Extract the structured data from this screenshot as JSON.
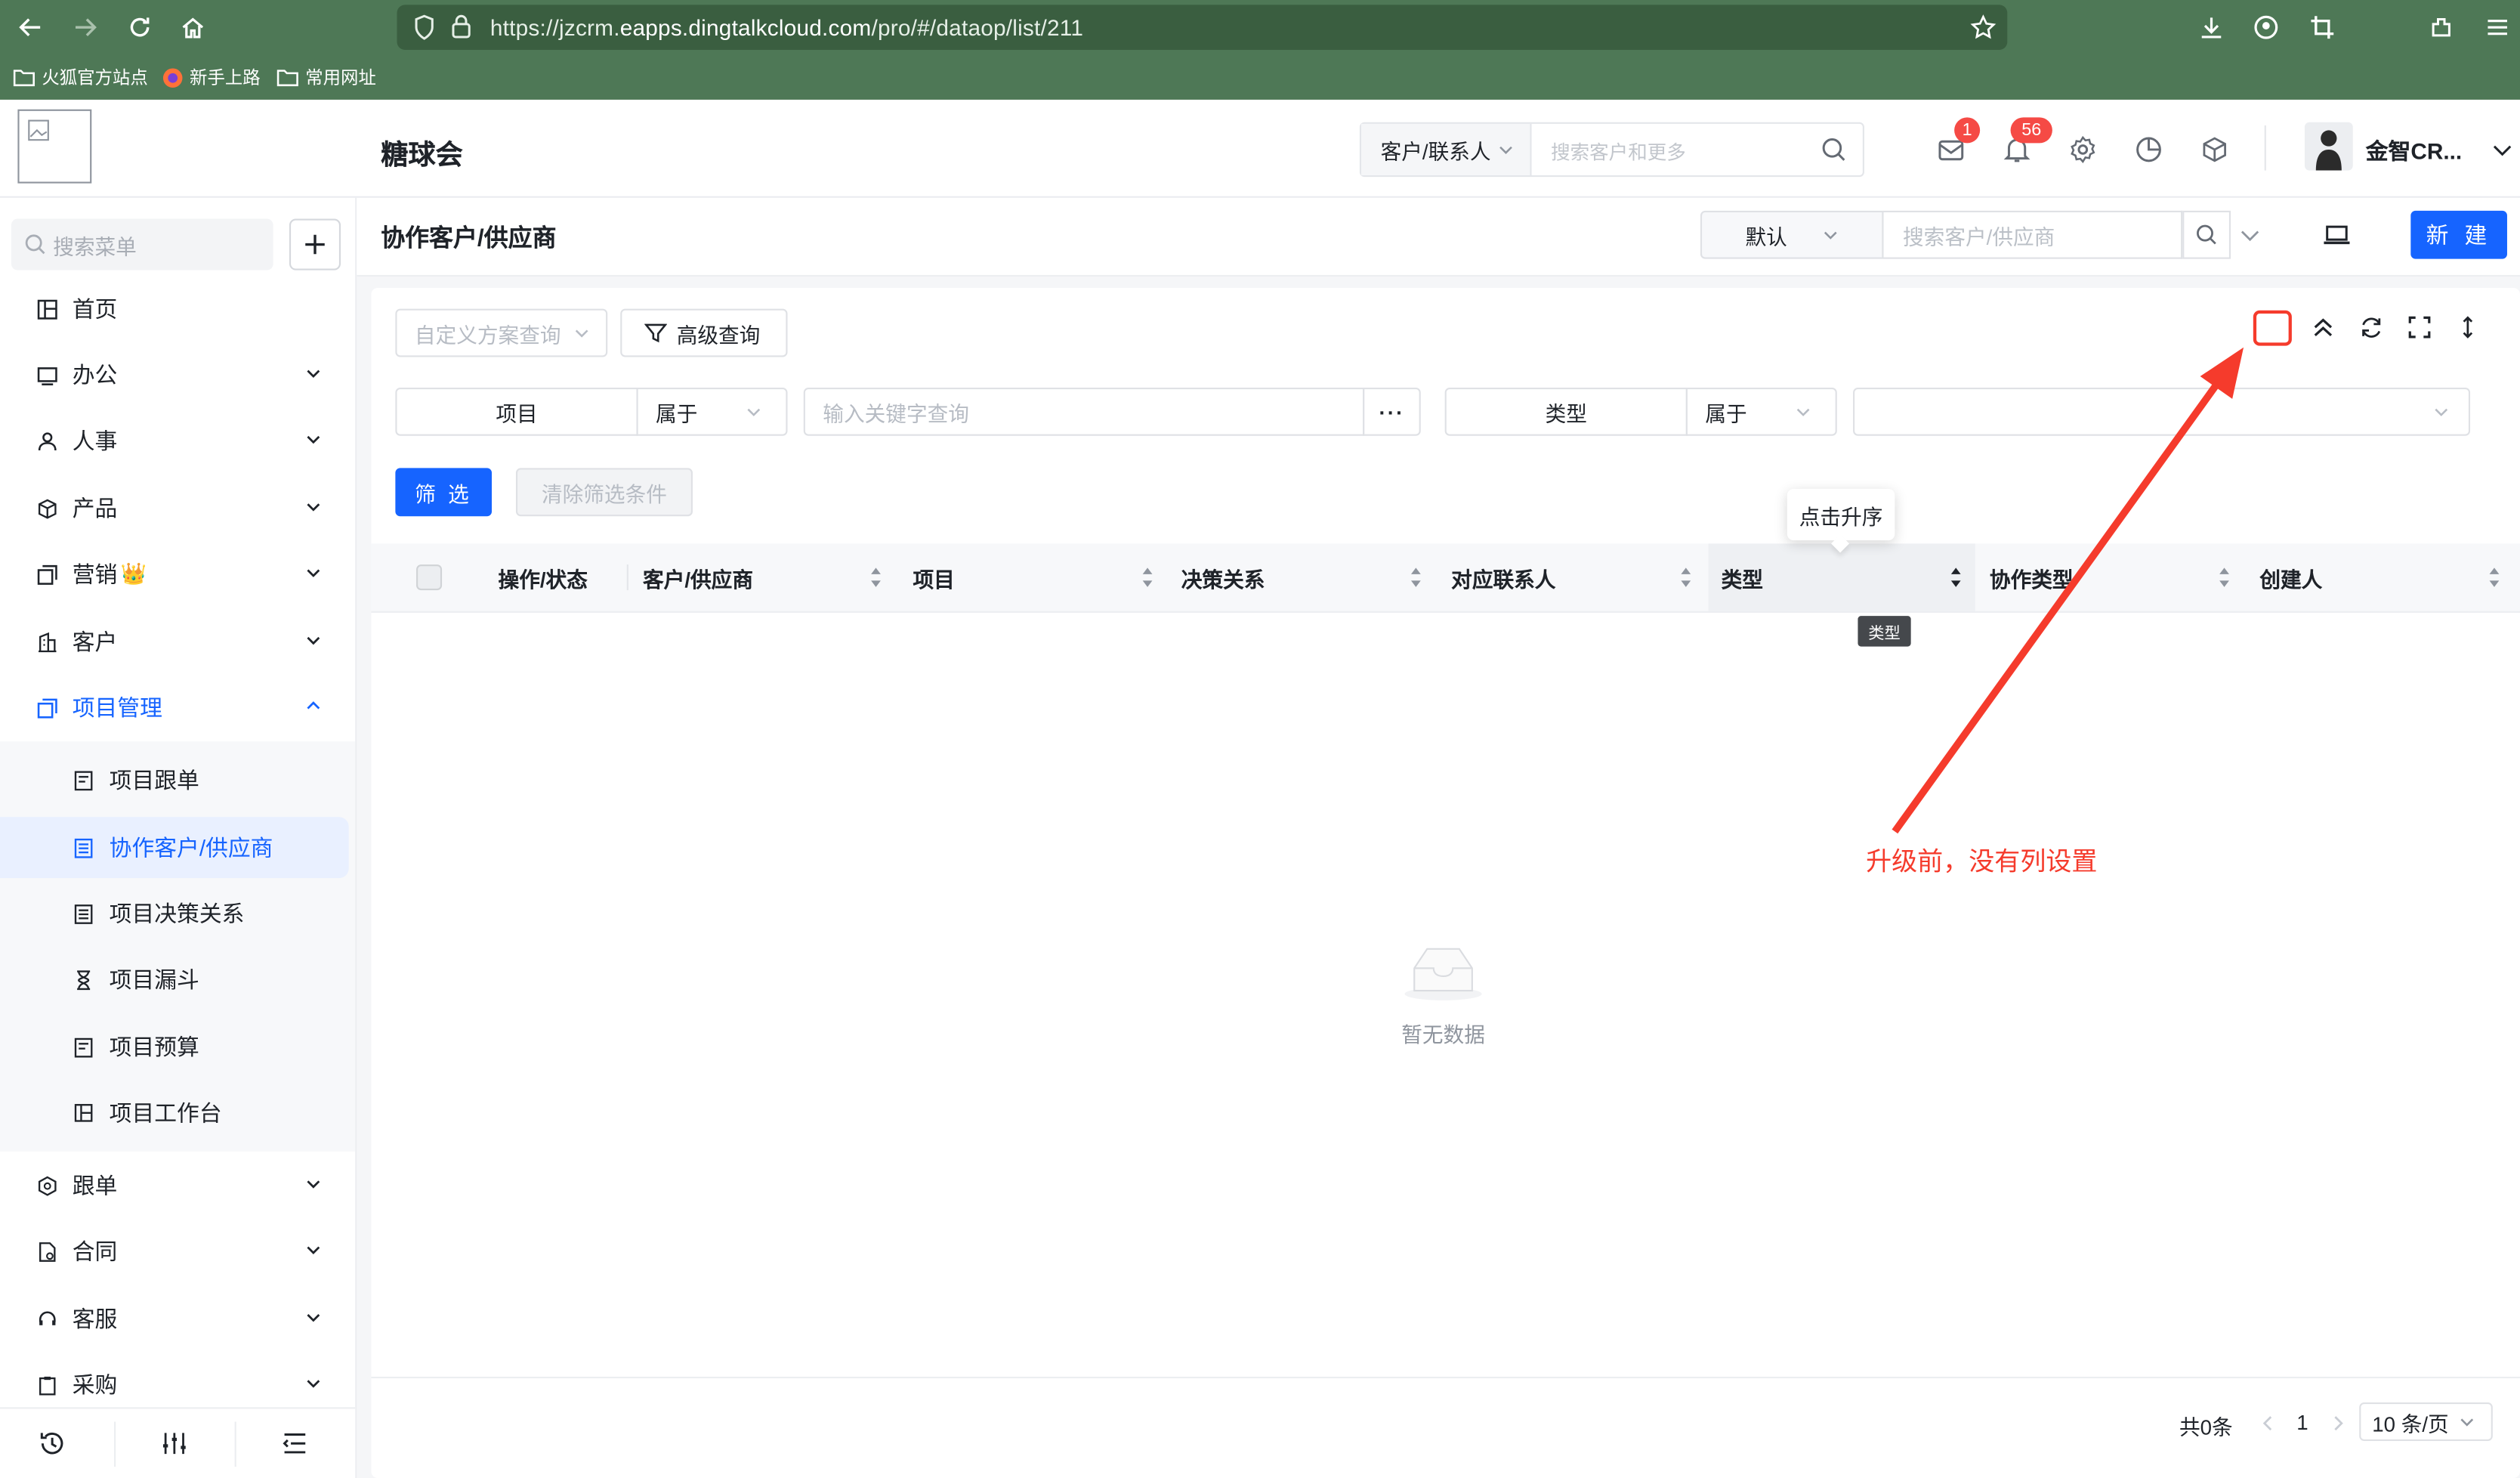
{
  "browser": {
    "url_prefix": "https://jzcrm.",
    "url_domain": "eapps.dingtalkcloud.com",
    "url_path": "/pro/#/dataop/list/211",
    "bookmarks": [
      "火狐官方站点",
      "新手上路",
      "常用网址"
    ]
  },
  "header": {
    "app_title": "糖球会",
    "search_type": "客户/联系人",
    "search_placeholder": "搜索客户和更多",
    "message_badge": "1",
    "notification_badge": "56",
    "user_name": "金智CR..."
  },
  "sidebar": {
    "search_placeholder": "搜索菜单",
    "items": [
      {
        "label": "首页"
      },
      {
        "label": "办公"
      },
      {
        "label": "人事"
      },
      {
        "label": "产品"
      },
      {
        "label": "营销",
        "badge": "👑"
      },
      {
        "label": "客户"
      },
      {
        "label": "项目管理"
      },
      {
        "label": "跟单"
      },
      {
        "label": "合同"
      },
      {
        "label": "客服"
      },
      {
        "label": "采购"
      }
    ],
    "sub_items": [
      {
        "label": "项目跟单"
      },
      {
        "label": "协作客户/供应商"
      },
      {
        "label": "项目决策关系"
      },
      {
        "label": "项目漏斗"
      },
      {
        "label": "项目预算"
      },
      {
        "label": "项目工作台"
      }
    ]
  },
  "page": {
    "title": "协作客户/供应商",
    "view_select": "默认",
    "search_placeholder": "搜索客户/供应商",
    "new_button": "新 建"
  },
  "filters": {
    "scheme_placeholder": "自定义方案查询",
    "advanced_button": "高级查询",
    "field1": "项目",
    "op1": "属于",
    "keyword_placeholder": "输入关键字查询",
    "more": "···",
    "field2": "类型",
    "op2": "属于",
    "filter_button": "筛 选",
    "clear_button": "清除筛选条件"
  },
  "table": {
    "columns": [
      "操作/状态",
      "客户/供应商",
      "项目",
      "决策关系",
      "对应联系人",
      "类型",
      "协作类型",
      "创建人"
    ],
    "tooltip": "点击升序",
    "hover_tip": "类型",
    "empty_text": "暂无数据"
  },
  "annotation": {
    "text": "升级前，没有列设置",
    "color": "#f53b2c"
  },
  "pagination": {
    "total": "共0条",
    "current": "1",
    "page_size": "10 条/页"
  },
  "colors": {
    "primary": "#1664ff",
    "browser_chrome": "#4e7856",
    "badge": "#f54a45"
  }
}
